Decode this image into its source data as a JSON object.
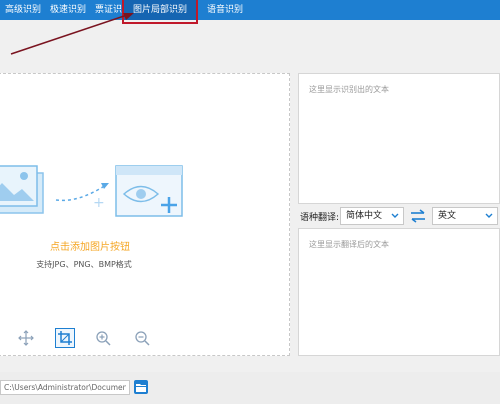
{
  "tabs": [
    {
      "label": "高级识别",
      "active": false
    },
    {
      "label": "极速识别",
      "active": false
    },
    {
      "label": "票证识别",
      "active": false
    },
    {
      "label": "图片局部识别",
      "active": true
    },
    {
      "label": "语音识别",
      "active": false
    }
  ],
  "upload": {
    "hint": "点击添加图片按钮",
    "formats": "支持JPG、PNG、BMP格式"
  },
  "tools": [
    "move-icon",
    "crop-icon",
    "zoom-in-icon",
    "zoom-out-icon"
  ],
  "recognized_text": {
    "placeholder": "这里显示识别出的文本"
  },
  "translation": {
    "label": "语种翻译:",
    "source_lang": "简体中文",
    "target_lang": "英文",
    "placeholder": "这里显示翻译后的文本"
  },
  "output_path": {
    "value": "C:\\Users\\Administrator\\Documents"
  },
  "colors": {
    "accent": "#1e7fd1",
    "annotation": "#c0182a",
    "hint": "#f5a623"
  }
}
